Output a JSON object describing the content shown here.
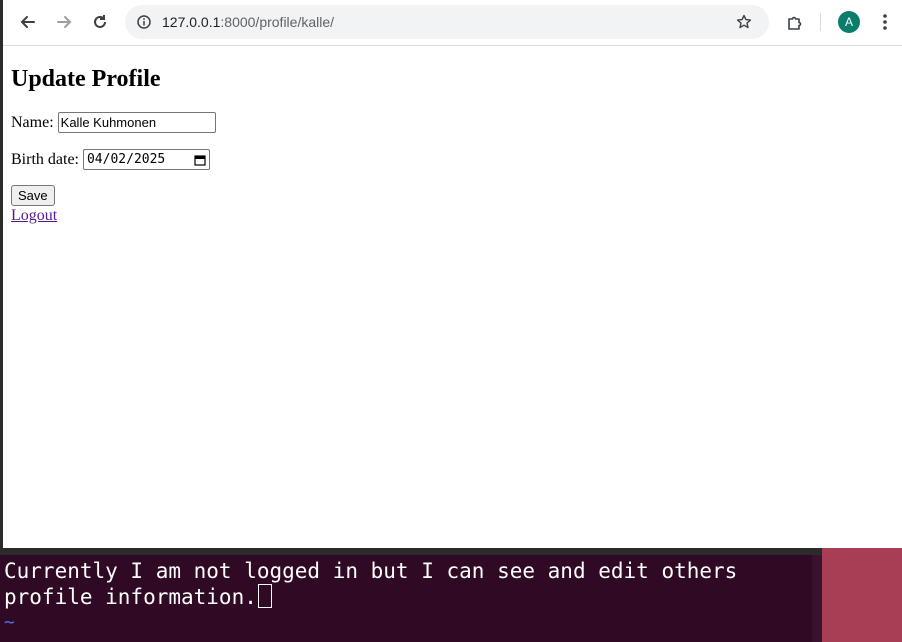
{
  "browser": {
    "url_host": "127.0.0.1",
    "url_path": ":8000/profile/kalle/",
    "profile_initial": "A"
  },
  "page": {
    "heading": "Update Profile",
    "name_label": "Name:",
    "name_value": "Kalle Kuhmonen",
    "birth_label": "Birth date:",
    "birth_value": "04/02/2025",
    "save_label": "Save",
    "logout_label": "Logout"
  },
  "terminal": {
    "text": "Currently I am not logged in but I can see and edit others profile information.",
    "empty_line_marker": "~"
  },
  "colors": {
    "link_visited": "#551a8b",
    "terminal_bg": "#300a24",
    "avatar_bg": "#0b7d6b"
  }
}
